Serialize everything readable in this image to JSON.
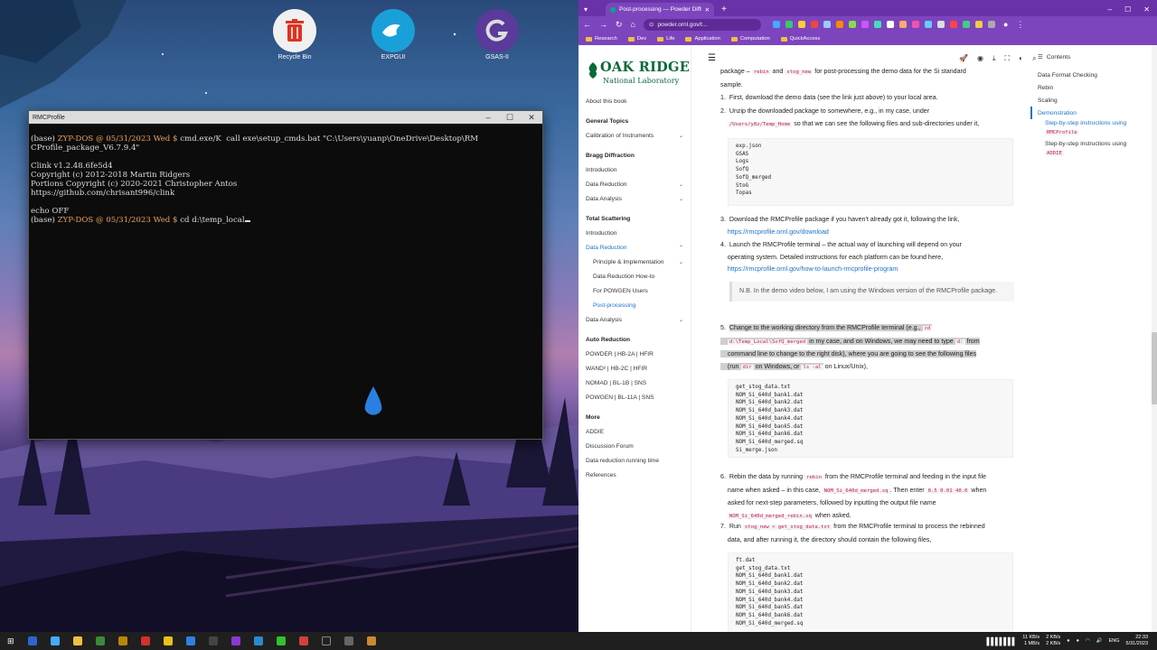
{
  "desktop": {
    "icons": [
      {
        "label": "Recycle Bin",
        "icon": "trash-icon"
      },
      {
        "label": "EXPGUI",
        "icon": "expgui-icon"
      },
      {
        "label": "GSAS-II",
        "icon": "gsas-icon"
      }
    ]
  },
  "terminal": {
    "title": "RMCProfile",
    "lines": [
      {
        "prompt": "(base) ",
        "user": "ZYP-DOS",
        "date": " @ 05/31/2023 Wed ",
        "sym": "$ ",
        "cmd": "cmd.exe/K  call exe\\setup_cmds.bat \"C:\\Users\\yuanp\\OneDrive\\Desktop\\RM"
      },
      {
        "text": "CProfile_package_V6.7.9.4\""
      },
      {
        "text": ""
      },
      {
        "text": "Clink v1.2.48.6fe5d4"
      },
      {
        "text": "Copyright (c) 2012-2018 Martin Ridgers"
      },
      {
        "text": "Portions Copyright (c) 2020-2021 Christopher Antos"
      },
      {
        "text": "https://github.com/chrisant996/clink"
      },
      {
        "text": ""
      },
      {
        "text": "echo OFF"
      },
      {
        "prompt": "(base) ",
        "user": "ZYP-DOS",
        "date": " @ 05/31/2023 Wed ",
        "sym": "$ ",
        "cmd": "cd d:\\temp_local"
      }
    ]
  },
  "browser": {
    "tab_title": "Post-processing — Powder Diffr",
    "url": "powder.ornl.gov/t...",
    "bookmarks": [
      "Research",
      "Dev",
      "Life",
      "Application",
      "Computation",
      "QuickAccess"
    ],
    "logo": {
      "line1": "OAK RIDGE",
      "line2": "National Laboratory"
    },
    "nav": [
      {
        "label": "About this book",
        "kind": "item"
      },
      {
        "label": "General Topics",
        "kind": "head"
      },
      {
        "label": "Calibration of Instruments",
        "kind": "item",
        "chev": "⌄"
      },
      {
        "label": "Bragg Diffraction",
        "kind": "head"
      },
      {
        "label": "Introduction",
        "kind": "item"
      },
      {
        "label": "Data Reduction",
        "kind": "item",
        "chev": "⌄"
      },
      {
        "label": "Data Analysis",
        "kind": "item",
        "chev": "⌄"
      },
      {
        "label": "Total Scattering",
        "kind": "head"
      },
      {
        "label": "Introduction",
        "kind": "item"
      },
      {
        "label": "Data Reduction",
        "kind": "act",
        "chev": "⌃"
      },
      {
        "label": "Principle & Implementation",
        "kind": "sub",
        "chev": "⌄"
      },
      {
        "label": "Data Reduction How-to",
        "kind": "sub"
      },
      {
        "label": "For POWGEN Users",
        "kind": "sub"
      },
      {
        "label": "Post-processing",
        "kind": "subact"
      },
      {
        "label": "Data Analysis",
        "kind": "item",
        "chev": "⌄"
      },
      {
        "label": "Auto Reduction",
        "kind": "head"
      },
      {
        "label": "POWDER | HB-2A | HFIR",
        "kind": "item"
      },
      {
        "label": "WAND² | HB-2C | HFIR",
        "kind": "item"
      },
      {
        "label": "NOMAD | BL-1B | SNS",
        "kind": "item"
      },
      {
        "label": "POWGEN | BL-11A | SNS",
        "kind": "item"
      },
      {
        "label": "More",
        "kind": "head"
      },
      {
        "label": "ADDIE",
        "kind": "item"
      },
      {
        "label": "Discussion Forum",
        "kind": "item"
      },
      {
        "label": "Data reduction running time",
        "kind": "item"
      },
      {
        "label": "References",
        "kind": "item"
      }
    ],
    "content": {
      "intro_a": "package – ",
      "intro_c1": "rebin",
      "intro_b": " and ",
      "intro_c2": "stog_new",
      "intro_d": " for post-processing the demo data for the Si standard",
      "intro_e": "sample.",
      "s1": "First, download the demo data (see the link just above) to your local area.",
      "s2a": "Unzip the downloaded package to somewhere, e.g., in my case, under",
      "s2c": "/Users/y8z/Temp_Home",
      "s2b": " so that we can see the following files and sub-directories under it,",
      "pre1": "exp.json\nGSAS\nLogs\nSofQ\nSofQ_merged\nStoG\nTopas",
      "s3": "Download the RMCProfile package if you haven't already got it, following the link,",
      "s3link": "https://rmcprofile.ornl.gov/download",
      "s4a": "Launch the RMCProfile terminal – the actual way of launching will depend on your",
      "s4b": "operating system. Detailed instructions for each platform can be found here,",
      "s4link": "https://rmcprofile.ornl.gov/how-to-launch-rmcprofile-program",
      "note": "N.B. In the demo video below, I am using the Windows version of the RMCProfile package.",
      "s5a": "Change to the working directory from the RMCProfile terminal (e.g.,",
      "s5c1": "cd",
      "s5c2": "d:\\Temp_Local\\SofQ_merged",
      "s5b": " in my case, and on Windows, we may need to type",
      "s5c3": "d:",
      "s5d": " from",
      "s5e": "command line to change to the right disk), where you are going to see the following files",
      "s5f": "(run",
      "s5c4": "dir",
      "s5g": " on Windows, or",
      "s5c5": "ls -al",
      "s5h": " on Linux/Unix),",
      "pre2": "get_stog_data.txt\nNOM_Si_640d_bank1.dat\nNOM_Si_640d_bank2.dat\nNOM_Si_640d_bank3.dat\nNOM_Si_640d_bank4.dat\nNOM_Si_640d_bank5.dat\nNOM_Si_640d_bank6.dat\nNOM_Si_640d_merged.sq\nSi_merge.json",
      "s6a": "Rebin the data by running",
      "s6c1": "rebin",
      "s6b": " from the RMCProfile terminal and feeding in the input file",
      "s6d": "name when asked – in this case,",
      "s6c2": "NOM_Si_640d_merged.sq",
      "s6e": ". Then enter",
      "s6c3": "0.5 0.01 40.0",
      "s6f": " when",
      "s6g": "asked for next-step parameters, followed by inputting the output file name",
      "s6c4": "NOM_Si_640d_merged_rebin.sq",
      "s6h": " when asked.",
      "s7a": "Run",
      "s7c": "stog_new < get_stog_data.txt",
      "s7b": " from the RMCProfile terminal to process the rebinned",
      "s7d": "data, and after running it, the directory should contain the following files,",
      "pre3": "ft.dat\nget_stog_data.txt\nNOM_Si_640d_bank1.dat\nNOM_Si_640d_bank2.dat\nNOM_Si_640d_bank3.dat\nNOM_Si_640d_bank4.dat\nNOM_Si_640d_bank5.dat\nNOM_Si_640d_bank6.dat\nNOM_Si_640d_merged.sq"
    },
    "toc": {
      "header": "Contents",
      "items": [
        "Data Format Checking",
        "Rebin",
        "Scaling",
        "Demonstration"
      ],
      "sub1": "Step-by-step instructions using",
      "sub1code": "RMCProfile",
      "sub2": "Step-by-step instructions using",
      "sub2code": "ADDIE"
    }
  },
  "taskbar": {
    "net_up": "11 KB/s",
    "net_down": "1 MB/s",
    "cpu1": "2 KB/s",
    "cpu2": "2 KB/s",
    "lang": "ENG",
    "time": "22:33",
    "date": "5/31/2023"
  }
}
